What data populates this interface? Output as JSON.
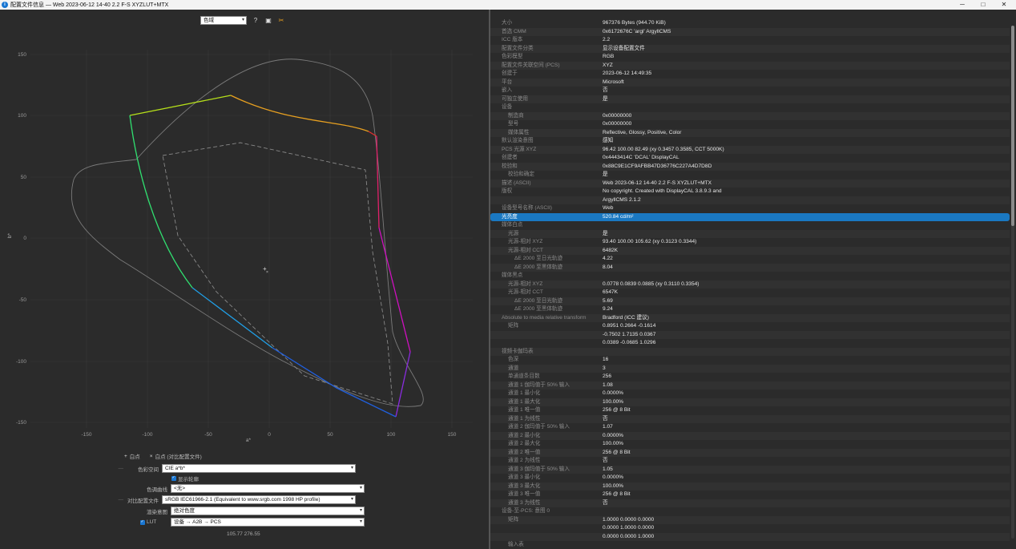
{
  "window": {
    "title": "配置文件信息 — Web 2023-06-12 14-40 2.2 F-S XYZLUT+MTX",
    "min": "─",
    "max": "□",
    "close": "✕"
  },
  "toolbar": {
    "mode": "色域",
    "help_icon": "?",
    "image_icon": "▣",
    "tool_icon": "✂"
  },
  "chart": {
    "xlabel": "a*",
    "ylabel": "b*",
    "x_ticks": [
      "-150",
      "-100",
      "-50",
      "0",
      "50",
      "100",
      "150"
    ],
    "y_ticks": [
      "150",
      "100",
      "50",
      "0",
      "-50",
      "-100",
      "-150"
    ],
    "colors": {
      "bg": "#2b2b2b",
      "grid": "#3a3a3a",
      "outline": "#7a7a7a"
    }
  },
  "controls": {
    "whitepoint": "白点",
    "whitepoint_compare": "白点 (对比配置文件)",
    "colorspace_label": "色彩空间",
    "colorspace_value": "CIE a*b*",
    "show_outline": "显示轮廓",
    "tone_curve_label": "色调曲线",
    "tone_curve_value": "<无>",
    "compare_profile_label": "对比配置文件",
    "compare_profile_value": "sRGB IEC61966-2.1 (Equivalent to www.srgb.com 1998 HP profile)",
    "intent_label": "渲染意图",
    "intent_value": "绝对色度",
    "lut_label": "LUT",
    "lut_value": "设备 → A2B → PCS",
    "coords": "105.77 276.55"
  },
  "props": [
    {
      "k": "大小",
      "v": "967376 Bytes (944.70 KiB)",
      "i": 0
    },
    {
      "k": "首选 CMM",
      "v": "0x6172676C 'argl' ArgyllCMS",
      "i": 0
    },
    {
      "k": "ICC 版本",
      "v": "2.2",
      "i": 0
    },
    {
      "k": "配置文件分类",
      "v": "显示设备配置文件",
      "i": 0
    },
    {
      "k": "色彩模型",
      "v": "RGB",
      "i": 0
    },
    {
      "k": "配置文件关联空间 (PCS)",
      "v": "XYZ",
      "i": 0
    },
    {
      "k": "创建于",
      "v": "2023-06-12 14:49:35",
      "i": 0
    },
    {
      "k": "平台",
      "v": "Microsoft",
      "i": 0
    },
    {
      "k": "嵌入",
      "v": "否",
      "i": 0
    },
    {
      "k": "可独立使用",
      "v": "是",
      "i": 0
    },
    {
      "k": "设备",
      "v": "",
      "i": 0
    },
    {
      "k": "制造商",
      "v": "0x00000000",
      "i": 1
    },
    {
      "k": "型号",
      "v": "0x00000000",
      "i": 1
    },
    {
      "k": "媒体属性",
      "v": "Reflective, Glossy, Positive, Color",
      "i": 1
    },
    {
      "k": "默认渲染意图",
      "v": "感知",
      "i": 0
    },
    {
      "k": "PCS 光源 XYZ",
      "v": "96.42 100.00  82.49 (xy 0.3457 0.3585, CCT 5000K)",
      "i": 0
    },
    {
      "k": "创建者",
      "v": "0x4443414C 'DCAL' DisplayCAL",
      "i": 0
    },
    {
      "k": "校验和",
      "v": "0x88C9E1CF9AFBB47D36776C227A4D7D8D",
      "i": 0
    },
    {
      "k": "校验和确定",
      "v": "是",
      "i": 1
    },
    {
      "k": "描述 (ASCII)",
      "v": "Web 2023-06-12 14-40 2.2 F-S XYZLUT+MTX",
      "i": 0
    },
    {
      "k": "版权",
      "v": "No copyright. Created with DisplayCAL 3.8.9.3 and",
      "i": 0
    },
    {
      "k": "",
      "v": "ArgyllCMS 2.1.2",
      "i": 0
    },
    {
      "k": "设备型号名称 (ASCII)",
      "v": "Web",
      "i": 0
    },
    {
      "k": "光亮度",
      "v": "520.84 cd/m²",
      "i": 0,
      "sel": true
    },
    {
      "k": "媒体白点",
      "v": "",
      "i": 0
    },
    {
      "k": "光源",
      "v": "是",
      "i": 1
    },
    {
      "k": "光源-相对 XYZ",
      "v": "93.40 100.00 105.62 (xy 0.3123 0.3344)",
      "i": 1
    },
    {
      "k": "光源-相对 CCT",
      "v": "6482K",
      "i": 1
    },
    {
      "k": "ΔE 2000 至日光轨迹",
      "v": "4.22",
      "i": 2
    },
    {
      "k": "ΔE 2000 至黑体轨迹",
      "v": "8.04",
      "i": 2
    },
    {
      "k": "媒体黑点",
      "v": "",
      "i": 0
    },
    {
      "k": "光源-相对 XYZ",
      "v": "0.0778 0.0839 0.0885 (xy 0.3110 0.3354)",
      "i": 1
    },
    {
      "k": "光源-相对 CCT",
      "v": "6547K",
      "i": 1
    },
    {
      "k": "ΔE 2000 至日光轨迹",
      "v": "5.69",
      "i": 2
    },
    {
      "k": "ΔE 2000 至黑体轨迹",
      "v": "9.24",
      "i": 2
    },
    {
      "k": "Absolute to media relative transform",
      "v": "Bradford (ICC 建议)",
      "i": 0
    },
    {
      "k": "矩阵",
      "v": "0.8951 0.2664 -0.1614",
      "i": 1
    },
    {
      "k": "",
      "v": "-0.7502 1.7135 0.0367",
      "i": 0
    },
    {
      "k": "",
      "v": "0.0389 -0.0685 1.0296",
      "i": 0
    },
    {
      "k": "视频卡伽玛表",
      "v": "",
      "i": 0
    },
    {
      "k": "色深",
      "v": "16",
      "i": 1
    },
    {
      "k": "通道",
      "v": "3",
      "i": 1
    },
    {
      "k": "单通道条目数",
      "v": "256",
      "i": 1
    },
    {
      "k": "通道 1 伽玛值于 50% 输入",
      "v": "1.08",
      "i": 1
    },
    {
      "k": "通道 1 最小化",
      "v": "0.0000%",
      "i": 1
    },
    {
      "k": "通道 1 最大化",
      "v": "100.00%",
      "i": 1
    },
    {
      "k": "通道 1 唯一值",
      "v": "256 @ 8 Bit",
      "i": 1
    },
    {
      "k": "通道 1 为线性",
      "v": "否",
      "i": 1
    },
    {
      "k": "通道 2 伽玛值于 50% 输入",
      "v": "1.07",
      "i": 1
    },
    {
      "k": "通道 2 最小化",
      "v": "0.0000%",
      "i": 1
    },
    {
      "k": "通道 2 最大化",
      "v": "100.00%",
      "i": 1
    },
    {
      "k": "通道 2 唯一值",
      "v": "256 @ 8 Bit",
      "i": 1
    },
    {
      "k": "通道 2 为线性",
      "v": "否",
      "i": 1
    },
    {
      "k": "通道 3 伽玛值于 50% 输入",
      "v": "1.05",
      "i": 1
    },
    {
      "k": "通道 3 最小化",
      "v": "0.0000%",
      "i": 1
    },
    {
      "k": "通道 3 最大化",
      "v": "100.00%",
      "i": 1
    },
    {
      "k": "通道 3 唯一值",
      "v": "256 @ 8 Bit",
      "i": 1
    },
    {
      "k": "通道 3 为线性",
      "v": "否",
      "i": 1
    },
    {
      "k": "设备-至-PCS: 意图 0",
      "v": "",
      "i": 0
    },
    {
      "k": "矩阵",
      "v": "1.0000 0.0000 0.0000",
      "i": 1
    },
    {
      "k": "",
      "v": "0.0000 1.0000 0.0000",
      "i": 0
    },
    {
      "k": "",
      "v": "0.0000 0.0000 1.0000",
      "i": 0
    },
    {
      "k": "输入表",
      "v": "",
      "i": 1
    }
  ]
}
